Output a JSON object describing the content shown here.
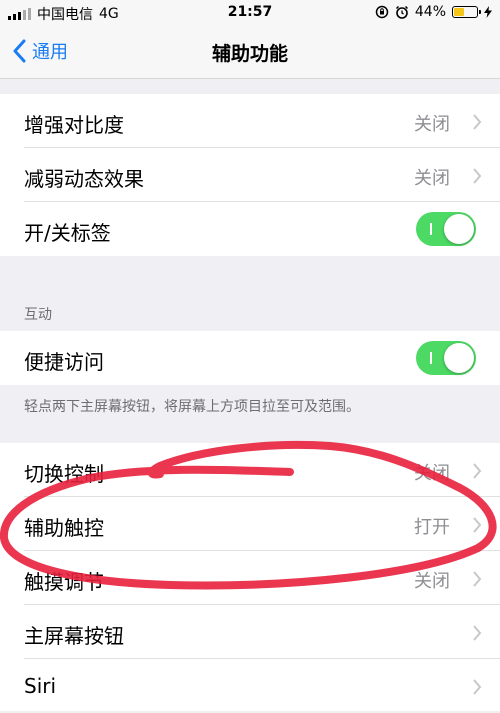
{
  "status_bar": {
    "carrier": "中国电信",
    "network": "4G",
    "time": "21:57",
    "battery_percent": "44%",
    "battery_level": 0.44
  },
  "nav": {
    "back_label": "通用",
    "title": "辅助功能"
  },
  "top_group": [
    {
      "label": "增强对比度",
      "value": "关闭"
    },
    {
      "label": "减弱动态效果",
      "value": "关闭"
    },
    {
      "label": "开/关标签",
      "toggle": true
    }
  ],
  "interaction": {
    "header": "互动",
    "row": {
      "label": "便捷访问",
      "toggle": true
    },
    "footer": "轻点两下主屏幕按钮，将屏幕上方项目拉至可及范围。"
  },
  "bottom_group": [
    {
      "label": "切换控制",
      "value": "关闭"
    },
    {
      "label": "辅助触控",
      "value": "打开"
    },
    {
      "label": "触摸调节",
      "value": "关闭"
    },
    {
      "label": "主屏幕按钮",
      "value": ""
    },
    {
      "label": "Siri",
      "value": ""
    }
  ],
  "colors": {
    "accent": "#1a7cf3",
    "toggle_on": "#4cd964",
    "annotation": "#e8203c"
  }
}
